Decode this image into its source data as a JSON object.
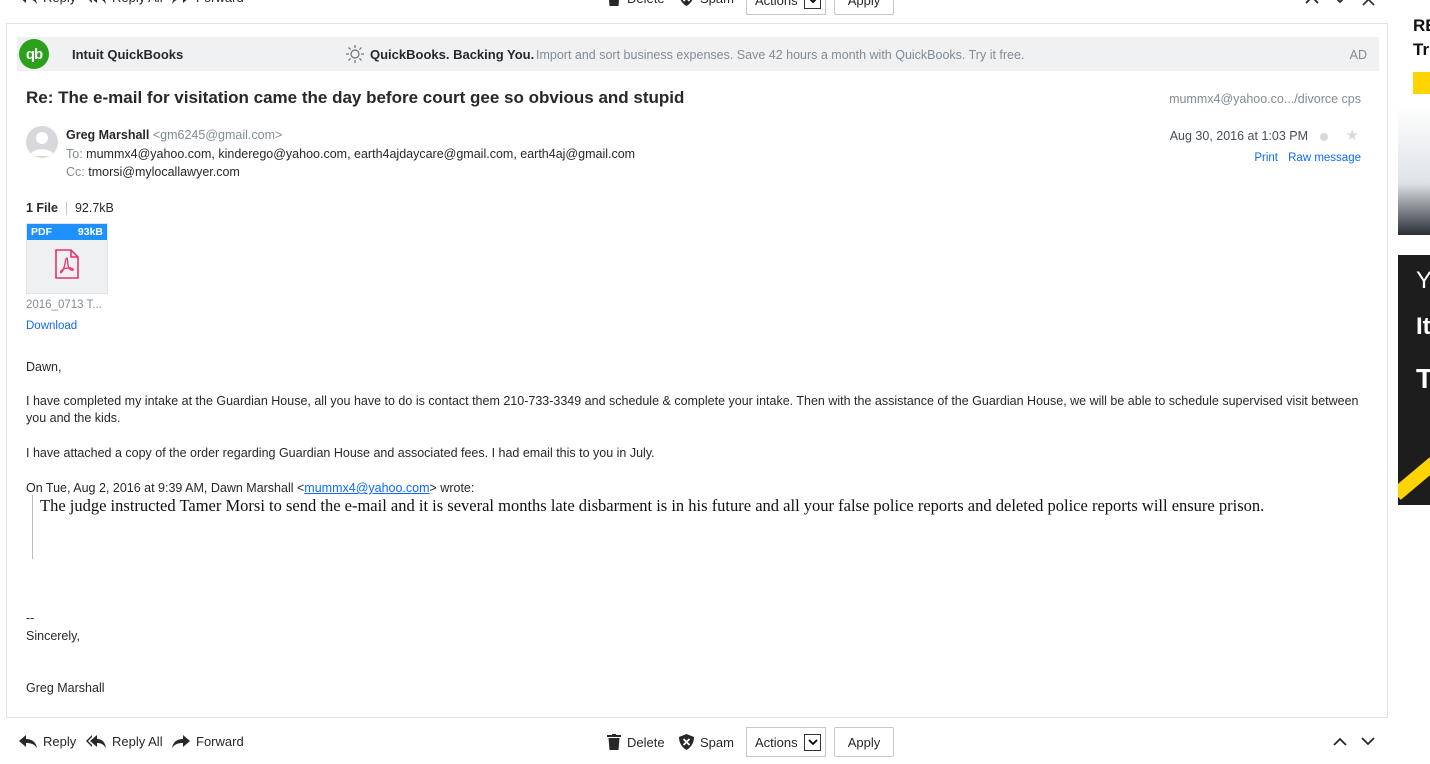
{
  "toolbar": {
    "reply": "Reply",
    "reply_all": "Reply All",
    "forward": "Forward",
    "delete": "Delete",
    "spam": "Spam",
    "actions": "Actions",
    "apply": "Apply"
  },
  "ad": {
    "sponsor": "Intuit QuickBooks",
    "logo_text": "qb",
    "headline": "QuickBooks. Backing You.",
    "body": "Import and sort business expenses. Save 42 hours a month with QuickBooks. Try it free.",
    "tag": "AD"
  },
  "message": {
    "subject": "Re: The e-mail for visitation came the day before court gee so obvious and stupid",
    "folder_path": "mummx4@yahoo.co.../divorce cps",
    "sender_name": "Greg Marshall",
    "sender_email": "<gm6245@gmail.com>",
    "to_label": "To:",
    "to": "mummx4@yahoo.com, kinderego@yahoo.com, earth4ajdaycare@gmail.com, earth4aj@gmail.com",
    "cc_label": "Cc:",
    "cc": "tmorsi@mylocallawyer.com",
    "date": "Aug 30, 2016 at 1:03 PM",
    "print": "Print",
    "raw_message": "Raw message"
  },
  "attachments": {
    "count_label": "1 File",
    "total_size": "92.7kB",
    "file_type": "PDF",
    "file_size": "93kB",
    "file_name": "2016_0713 T...",
    "download": "Download"
  },
  "body": {
    "greeting": "Dawn,",
    "para1": "I have completed my intake at the Guardian House, all you have to do is contact them 210-733-3349 and schedule & complete your intake.  Then with the assistance of the Guardian House, we will be able to schedule supervised visit between you and the kids.",
    "para2": "I have attached a copy of the order regarding Guardian House and associated fees.  I had email this to you in July.",
    "quote_prefix": "On Tue, Aug 2, 2016 at 9:39 AM, Dawn Marshall <",
    "quote_email": "mummx4@yahoo.com",
    "quote_suffix": "> wrote:",
    "quote_text": "The judge instructed Tamer Morsi to send the e-mail and it is several months late disbarment is in his future and all your false police reports and deleted police reports will ensure prison.",
    "sig_dash": "--",
    "sig_closing": "Sincerely,",
    "sig_name": "Greg Marshall"
  },
  "rail": {
    "line1": "RE",
    "line2": "Tr",
    "promo1": "Y",
    "promo2": "It",
    "promo3": "T"
  },
  "colors": {
    "link": "#0f69ff",
    "qb_green": "#2ca01c",
    "attachment_header": "#1e91ff",
    "pdf_icon": "#e8336b",
    "rail_dark": "#1d1d1d",
    "rail_yellow": "#ffd400"
  }
}
